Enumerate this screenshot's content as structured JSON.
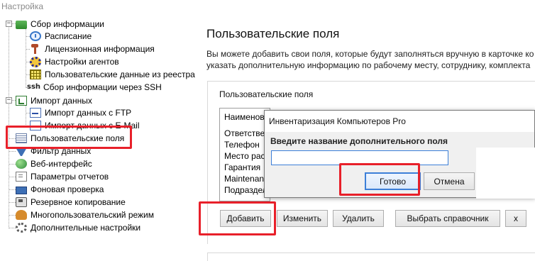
{
  "window": {
    "title": "Настройка"
  },
  "tree": {
    "items": [
      {
        "label": "Сбор информации",
        "icon": "folder-icon"
      },
      {
        "label": "Расписание",
        "icon": "clock-icon"
      },
      {
        "label": "Лицензионная информация",
        "icon": "key-icon"
      },
      {
        "label": "Настройки агентов",
        "icon": "gear-icon"
      },
      {
        "label": "Пользовательские данные из реестра",
        "icon": "registry-grid-icon"
      },
      {
        "label": "Сбор информации через SSH",
        "icon": "ssh-icon",
        "icon_text": "ssh"
      },
      {
        "label": "Импорт данных",
        "icon": "import-icon"
      },
      {
        "label": "Импорт данных с FTP",
        "icon": "ftp-import-icon"
      },
      {
        "label": "Импорт данных с E-Mail",
        "icon": "email-import-icon"
      },
      {
        "label": "Пользовательские поля",
        "icon": "list-icon"
      },
      {
        "label": "Фильтр данных",
        "icon": "funnel-icon"
      },
      {
        "label": "Веб-интерфейс",
        "icon": "globe-icon"
      },
      {
        "label": "Параметры отчетов",
        "icon": "report-icon"
      },
      {
        "label": "Фоновая проверка",
        "icon": "monitor-icon"
      },
      {
        "label": "Резервное копирование",
        "icon": "backup-icon"
      },
      {
        "label": "Многопользовательский режим",
        "icon": "users-icon"
      },
      {
        "label": "Дополнительные настройки",
        "icon": "settings-icon"
      }
    ],
    "expanders": [
      "−",
      "+"
    ]
  },
  "main": {
    "title": "Пользовательские поля",
    "description_line1": "Вы можете добавить свои поля, которые будут заполняться вручную в карточке ко",
    "description_line2": "указать дополнительную информацию по рабочему месту, сотруднику, комплекта",
    "panel_title": "Пользовательские поля",
    "list": {
      "header": "Наименова",
      "rows": [
        "Ответствен",
        "Телефон",
        "Место рас",
        "Гарантия",
        "Maintenanc",
        "Подраздел"
      ]
    },
    "buttons": {
      "add": "Добавить",
      "edit": "Изменить",
      "delete": "Удалить",
      "choose_reference": "Выбрать справочник",
      "close": "x"
    }
  },
  "dialog": {
    "title": "Инвентаризация Компьютеров Pro",
    "prompt": "Введите название дополнительного поля",
    "input_value": "",
    "ok": "Готово",
    "cancel": "Отмена"
  },
  "colors": {
    "highlight": "#e8202a",
    "accent": "#3c7fd8"
  }
}
